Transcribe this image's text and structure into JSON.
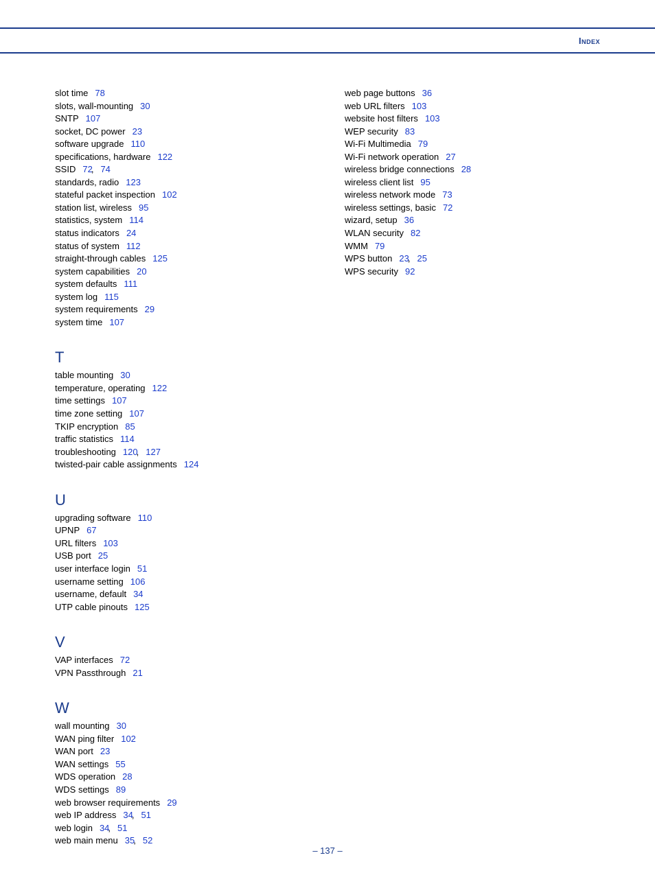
{
  "header": {
    "title": "Index"
  },
  "footer": {
    "page": "– 137 –"
  },
  "left": [
    {
      "type": "entry",
      "text": "slot time",
      "pages": [
        "78"
      ]
    },
    {
      "type": "entry",
      "text": "slots, wall-mounting",
      "pages": [
        "30"
      ]
    },
    {
      "type": "entry",
      "text": "SNTP",
      "pages": [
        "107"
      ]
    },
    {
      "type": "entry",
      "text": "socket, DC power",
      "pages": [
        "23"
      ]
    },
    {
      "type": "entry",
      "text": "software upgrade",
      "pages": [
        "110"
      ]
    },
    {
      "type": "entry",
      "text": "specifications, hardware",
      "pages": [
        "122"
      ]
    },
    {
      "type": "entry",
      "text": "SSID",
      "pages": [
        "72",
        "74"
      ]
    },
    {
      "type": "entry",
      "text": "standards, radio",
      "pages": [
        "123"
      ]
    },
    {
      "type": "entry",
      "text": "stateful packet inspection",
      "pages": [
        "102"
      ]
    },
    {
      "type": "entry",
      "text": "station list, wireless",
      "pages": [
        "95"
      ]
    },
    {
      "type": "entry",
      "text": "statistics, system",
      "pages": [
        "114"
      ]
    },
    {
      "type": "entry",
      "text": "status indicators",
      "pages": [
        "24"
      ]
    },
    {
      "type": "entry",
      "text": "status of system",
      "pages": [
        "112"
      ]
    },
    {
      "type": "entry",
      "text": "straight-through cables",
      "pages": [
        "125"
      ]
    },
    {
      "type": "entry",
      "text": "system capabilities",
      "pages": [
        "20"
      ]
    },
    {
      "type": "entry",
      "text": "system defaults",
      "pages": [
        "111"
      ]
    },
    {
      "type": "entry",
      "text": "system log",
      "pages": [
        "115"
      ]
    },
    {
      "type": "entry",
      "text": "system requirements",
      "pages": [
        "29"
      ]
    },
    {
      "type": "entry",
      "text": "system time",
      "pages": [
        "107"
      ]
    },
    {
      "type": "letter",
      "text": "T"
    },
    {
      "type": "entry",
      "text": "table mounting",
      "pages": [
        "30"
      ]
    },
    {
      "type": "entry",
      "text": "temperature, operating",
      "pages": [
        "122"
      ]
    },
    {
      "type": "entry",
      "text": "time settings",
      "pages": [
        "107"
      ]
    },
    {
      "type": "entry",
      "text": "time zone setting",
      "pages": [
        "107"
      ]
    },
    {
      "type": "entry",
      "text": "TKIP encryption",
      "pages": [
        "85"
      ]
    },
    {
      "type": "entry",
      "text": "traffic statistics",
      "pages": [
        "114"
      ]
    },
    {
      "type": "entry",
      "text": "troubleshooting",
      "pages": [
        "120",
        "127"
      ]
    },
    {
      "type": "entry",
      "text": "twisted-pair cable assignments",
      "pages": [
        "124"
      ]
    },
    {
      "type": "letter",
      "text": "U"
    },
    {
      "type": "entry",
      "text": "upgrading software",
      "pages": [
        "110"
      ]
    },
    {
      "type": "entry",
      "text": "UPNP",
      "pages": [
        "67"
      ]
    },
    {
      "type": "entry",
      "text": "URL filters",
      "pages": [
        "103"
      ]
    },
    {
      "type": "entry",
      "text": "USB port",
      "pages": [
        "25"
      ]
    },
    {
      "type": "entry",
      "text": "user interface login",
      "pages": [
        "51"
      ]
    },
    {
      "type": "entry",
      "text": "username setting",
      "pages": [
        "106"
      ]
    },
    {
      "type": "entry",
      "text": "username, default",
      "pages": [
        "34"
      ]
    },
    {
      "type": "entry",
      "text": "UTP cable pinouts",
      "pages": [
        "125"
      ]
    },
    {
      "type": "letter",
      "text": "V"
    },
    {
      "type": "entry",
      "text": "VAP interfaces",
      "pages": [
        "72"
      ]
    },
    {
      "type": "entry",
      "text": "VPN Passthrough",
      "pages": [
        "21"
      ]
    },
    {
      "type": "letter",
      "text": "W"
    },
    {
      "type": "entry",
      "text": "wall mounting",
      "pages": [
        "30"
      ]
    },
    {
      "type": "entry",
      "text": "WAN ping filter",
      "pages": [
        "102"
      ]
    },
    {
      "type": "entry",
      "text": "WAN port",
      "pages": [
        "23"
      ]
    },
    {
      "type": "entry",
      "text": "WAN settings",
      "pages": [
        "55"
      ]
    },
    {
      "type": "entry",
      "text": "WDS operation",
      "pages": [
        "28"
      ]
    },
    {
      "type": "entry",
      "text": "WDS settings",
      "pages": [
        "89"
      ]
    },
    {
      "type": "entry",
      "text": "web browser requirements",
      "pages": [
        "29"
      ]
    },
    {
      "type": "entry",
      "text": "web IP address",
      "pages": [
        "34",
        "51"
      ]
    },
    {
      "type": "entry",
      "text": "web login",
      "pages": [
        "34",
        "51"
      ]
    },
    {
      "type": "entry",
      "text": "web main menu",
      "pages": [
        "35",
        "52"
      ]
    }
  ],
  "right": [
    {
      "type": "entry",
      "text": "web page buttons",
      "pages": [
        "36"
      ]
    },
    {
      "type": "entry",
      "text": "web URL filters",
      "pages": [
        "103"
      ]
    },
    {
      "type": "entry",
      "text": "website host filters",
      "pages": [
        "103"
      ]
    },
    {
      "type": "entry",
      "text": "WEP security",
      "pages": [
        "83"
      ]
    },
    {
      "type": "entry",
      "text": "Wi-Fi Multimedia",
      "pages": [
        "79"
      ]
    },
    {
      "type": "entry",
      "text": "Wi-Fi network operation",
      "pages": [
        "27"
      ]
    },
    {
      "type": "entry",
      "text": "wireless bridge connections",
      "pages": [
        "28"
      ]
    },
    {
      "type": "entry",
      "text": "wireless client list",
      "pages": [
        "95"
      ]
    },
    {
      "type": "entry",
      "text": "wireless network mode",
      "pages": [
        "73"
      ]
    },
    {
      "type": "entry",
      "text": "wireless settings, basic",
      "pages": [
        "72"
      ]
    },
    {
      "type": "entry",
      "text": "wizard, setup",
      "pages": [
        "36"
      ]
    },
    {
      "type": "entry",
      "text": "WLAN security",
      "pages": [
        "82"
      ]
    },
    {
      "type": "entry",
      "text": "WMM",
      "pages": [
        "79"
      ]
    },
    {
      "type": "entry",
      "text": "WPS button",
      "pages": [
        "23",
        "25"
      ]
    },
    {
      "type": "entry",
      "text": "WPS security",
      "pages": [
        "92"
      ]
    }
  ]
}
